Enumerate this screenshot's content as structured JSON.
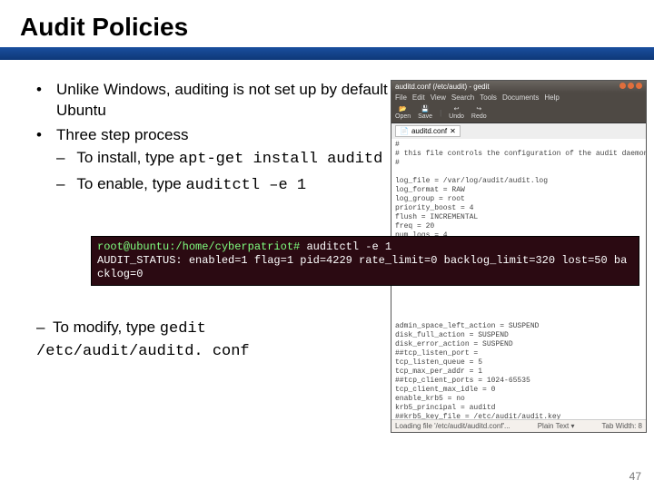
{
  "title": "Audit Policies",
  "bullets": {
    "b1": "Unlike Windows,  auditing is not set up by default in Ubuntu",
    "b2": "Three step process",
    "s1_a": "To install, type ",
    "s1_code": "apt-get install auditd",
    "s2_a": "To enable, type ",
    "s2_code": "auditctl –e 1",
    "s3_a": "To modify, type ",
    "s3_code": "gedit /etc/audit/auditd. conf"
  },
  "terminal": {
    "prompt": "root@ubuntu:/home/cyberpatriot#",
    "cmd": " auditctl -e 1",
    "out": "AUDIT_STATUS: enabled=1 flag=1 pid=4229 rate_limit=0 backlog_limit=320 lost=50 backlog=0"
  },
  "gedit": {
    "title": "auditd.conf (/etc/audit) - gedit",
    "menus": [
      "File",
      "Edit",
      "View",
      "Search",
      "Tools",
      "Documents",
      "Help"
    ],
    "toolbar": [
      "Open",
      "Save",
      "Undo",
      "Redo"
    ],
    "tab": "auditd.conf",
    "body": "#\n# this file controls the configuration of the audit daemon\n#\n\nlog_file = /var/log/audit/audit.log\nlog_format = RAW\nlog_group = root\npriority_boost = 4\nflush = INCREMENTAL\nfreq = 20\nnum_logs = 4\ndisp_qos = lossy\ndispatcher = /sbin/audispd\nname_format = NONE\n##name = mydomain\nmax_log_file = 5\n\n\n\n\nadmin_space_left_action = SUSPEND\ndisk_full_action = SUSPEND\ndisk_error_action = SUSPEND\n##tcp_listen_port =\ntcp_listen_queue = 5\ntcp_max_per_addr = 1\n##tcp_client_ports = 1024-65535\ntcp_client_max_idle = 0\nenable_krb5 = no\nkrb5_principal = auditd\n##krb5_key_file = /etc/audit/audit.key",
    "status_left": "Loading file '/etc/audit/auditd.conf'...",
    "status_mid": "Plain Text ▾",
    "status_right": "Tab Width: 8"
  },
  "page_number": "47"
}
